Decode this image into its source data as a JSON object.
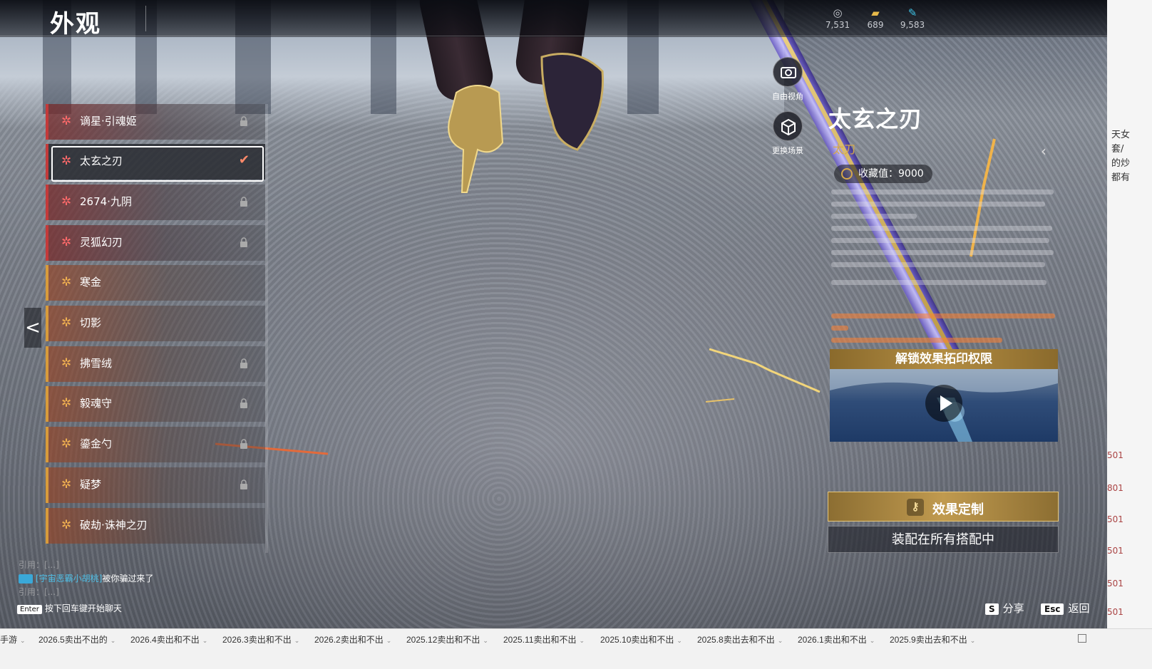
{
  "header": {
    "title": "外观",
    "currencies": [
      {
        "icon": "coin-stack-icon",
        "value": "7,531"
      },
      {
        "icon": "ticket-icon",
        "value": "689"
      },
      {
        "icon": "feather-icon",
        "value": "9,583"
      }
    ]
  },
  "camera_buttons": [
    {
      "icon": "camera-icon",
      "label": "自由视角"
    },
    {
      "icon": "cube-icon",
      "label": "更换场景"
    }
  ],
  "list": {
    "items": [
      {
        "label": "谪星·引魂姬",
        "tier": "red",
        "locked": true,
        "selected": false
      },
      {
        "label": "太玄之刃",
        "tier": "red",
        "locked": false,
        "selected": true
      },
      {
        "label": "2674·九阴",
        "tier": "red",
        "locked": true,
        "selected": false
      },
      {
        "label": "灵狐幻刃",
        "tier": "red",
        "locked": true,
        "selected": false
      },
      {
        "label": "寒金",
        "tier": "orange",
        "locked": false,
        "selected": false
      },
      {
        "label": "切影",
        "tier": "orange",
        "locked": false,
        "selected": false
      },
      {
        "label": "拂雪绒",
        "tier": "orange",
        "locked": true,
        "selected": false
      },
      {
        "label": "毅魂守",
        "tier": "orange",
        "locked": true,
        "selected": false
      },
      {
        "label": "鎏金勺",
        "tier": "orange",
        "locked": true,
        "selected": false
      },
      {
        "label": "疑梦",
        "tier": "orange",
        "locked": true,
        "selected": false
      },
      {
        "label": "破劫·诛神之刃",
        "tier": "orange",
        "locked": false,
        "selected": false
      }
    ]
  },
  "detail": {
    "name": "太玄之刃",
    "type": "太刀",
    "collect_value": "收藏值：9000",
    "unlock_title": "解锁效果拓印权限",
    "custom_button": "效果定制",
    "equip_button": "装配在所有搭配中"
  },
  "chat": {
    "quote1": "引用：[...]",
    "sender": "[宇宙恶霸小胡桃]",
    "message": "被你骗过来了",
    "quote2": "引用：[...]",
    "enter_key": "Enter",
    "enter_hint": "按下回车键开始聊天"
  },
  "hotkeys": [
    {
      "key": "S",
      "label": "分享"
    },
    {
      "key": "Esc",
      "label": "返回"
    }
  ],
  "side_strip": {
    "cut_text": [
      "天女",
      "套/",
      "的炒",
      "都有"
    ],
    "numbers": [
      "501",
      "801",
      "501",
      "501",
      "501",
      "501",
      "101"
    ]
  },
  "sheet_tabs": [
    "手游",
    "2026.5卖出不出的",
    "2026.4卖出和不出",
    "2026.3卖出和不出",
    "2026.2卖出和不出",
    "2025.12卖出和不出",
    "2025.11卖出和不出",
    "2025.10卖出和不出",
    "2025.8卖出去和不出",
    "2026.1卖出和不出",
    "2025.9卖出去和不出"
  ]
}
